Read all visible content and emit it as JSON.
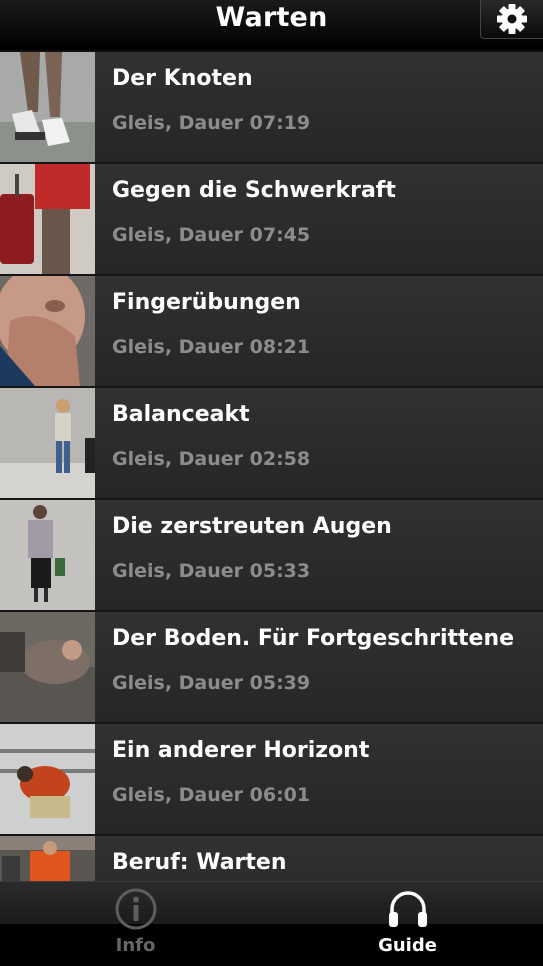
{
  "header": {
    "title": "Warten",
    "settings_icon": "gear-icon"
  },
  "items": [
    {
      "title": "Der Knoten",
      "subtitle": "Gleis, Dauer 07:19"
    },
    {
      "title": "Gegen die Schwerkraft",
      "subtitle": "Gleis, Dauer 07:45"
    },
    {
      "title": "Fingerübungen",
      "subtitle": "Gleis, Dauer 08:21"
    },
    {
      "title": "Balanceakt",
      "subtitle": "Gleis, Dauer 02:58"
    },
    {
      "title": "Die zerstreuten Augen",
      "subtitle": "Gleis, Dauer 05:33"
    },
    {
      "title": "Der Boden. Für Fortgeschrittene",
      "subtitle": "Gleis, Dauer 05:39"
    },
    {
      "title": "Ein anderer Horizont",
      "subtitle": "Gleis, Dauer 06:01"
    },
    {
      "title": "Beruf: Warten",
      "subtitle": ""
    }
  ],
  "tabs": {
    "info": {
      "label": "Info",
      "icon": "info-icon",
      "active": false
    },
    "guide": {
      "label": "Guide",
      "icon": "headphones-icon",
      "active": true
    }
  },
  "colors": {
    "subtitle": "#8c8c8c",
    "inactive_tab": "#666666",
    "background": "#2a2a2a"
  }
}
